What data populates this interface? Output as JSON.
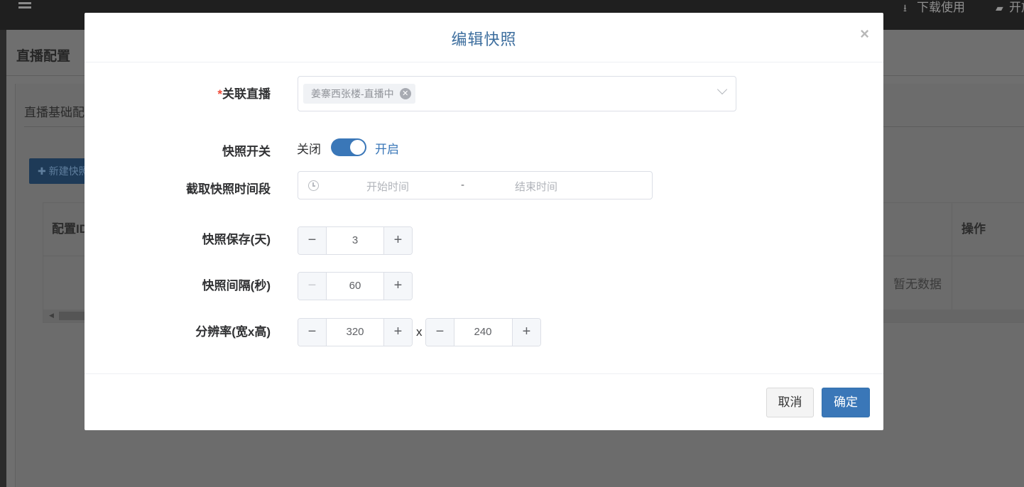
{
  "topbar": {
    "download_label": "下载使用",
    "open_label": "开放"
  },
  "page": {
    "title": "直播配置",
    "card_title": "直播基础配置",
    "new_button": "新建快照",
    "table": {
      "col_config_id": "配置ID",
      "col_actions": "操作",
      "empty_text": "暂无数据"
    }
  },
  "modal": {
    "title": "编辑快照",
    "close_symbol": "×",
    "fields": {
      "live_label": "关联直播",
      "live_required_mark": "*",
      "live_tag": "姜寨西张楼-直播中",
      "switch_label": "快照开关",
      "switch_off": "关闭",
      "switch_on": "开启",
      "switch_state": "on",
      "time_range_label": "截取快照时间段",
      "start_placeholder": "开始时间",
      "end_placeholder": "结束时间",
      "range_separator": "-",
      "retention_label": "快照保存(天)",
      "retention_value": "3",
      "interval_label": "快照间隔(秒)",
      "interval_value": "60",
      "resolution_label": "分辨率(宽x高)",
      "width_value": "320",
      "height_value": "240",
      "times_symbol": "x"
    },
    "stepper_minus": "−",
    "stepper_plus": "+",
    "cancel_label": "取消",
    "confirm_label": "确定"
  },
  "colors": {
    "primary": "#3a77b8",
    "title": "#3d6e9e",
    "required": "#f04b38"
  }
}
